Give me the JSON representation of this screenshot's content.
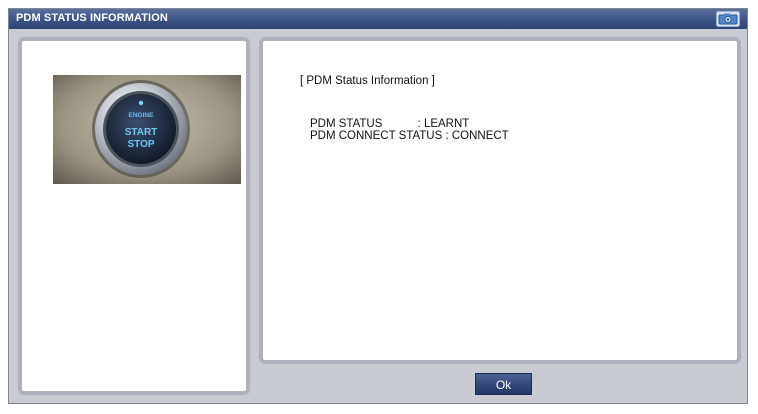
{
  "window": {
    "title": "PDM STATUS INFORMATION",
    "camera_icon": "camera-icon"
  },
  "image": {
    "description_icon": "engine-start-stop-button-photo",
    "button_text_top": "ENGINE",
    "button_text_mid": "START",
    "button_text_bottom": "STOP"
  },
  "info": {
    "heading": "[ PDM Status Information ]",
    "lines": [
      "PDM STATUS           : LEARNT",
      "PDM CONNECT STATUS : CONNECT"
    ]
  },
  "footer": {
    "ok_label": "Ok"
  },
  "colors": {
    "titlebar": "#3b5386",
    "panel_border": "#aeb1bd",
    "content_bg": "#c9cbd3",
    "ok_button": "#2f4478"
  }
}
